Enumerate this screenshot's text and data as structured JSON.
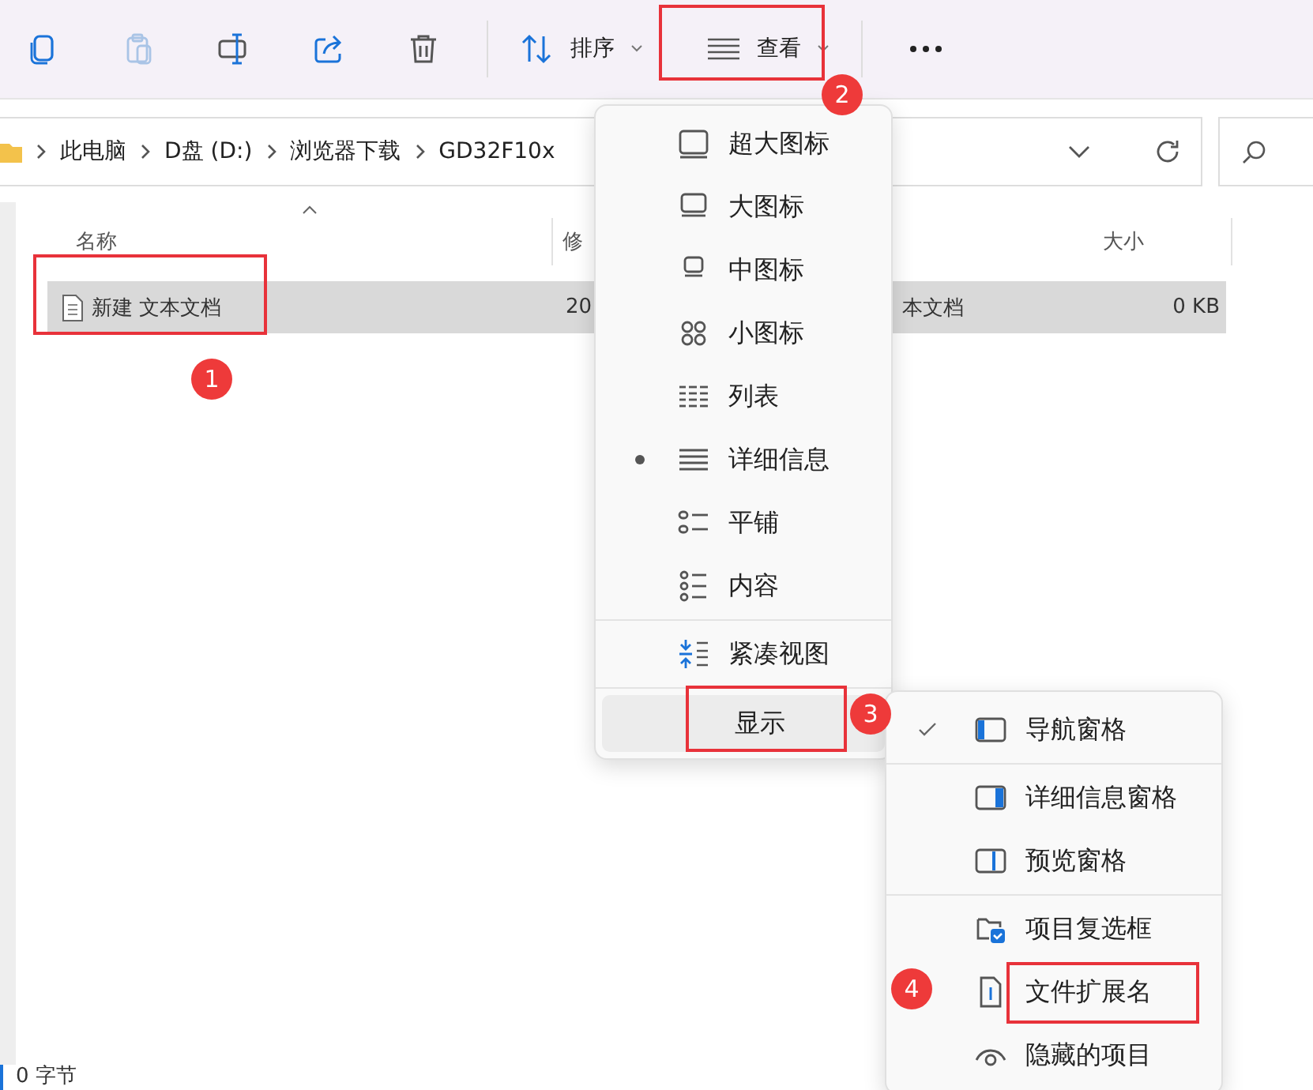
{
  "toolbar": {
    "sort_label": "排序",
    "view_label": "查看"
  },
  "address_bar": {
    "crumbs": [
      "此电脑",
      "D盘 (D:)",
      "浏览器下载",
      "GD32F10x"
    ]
  },
  "file_list": {
    "columns": [
      "名称",
      "修",
      "大小"
    ],
    "rows": [
      {
        "name": "新建 文本文档",
        "date": "20",
        "type": "本文档",
        "size": "0 KB",
        "selected": true
      }
    ]
  },
  "view_menu": {
    "items": [
      {
        "label": "超大图标",
        "selected": false
      },
      {
        "label": "大图标",
        "selected": false
      },
      {
        "label": "中图标",
        "selected": false
      },
      {
        "label": "小图标",
        "selected": false
      },
      {
        "label": "列表",
        "selected": false
      },
      {
        "label": "详细信息",
        "selected": true
      },
      {
        "label": "平铺",
        "selected": false
      },
      {
        "label": "内容",
        "selected": false
      }
    ],
    "compact_label": "紧凑视图",
    "show_label": "显示"
  },
  "show_menu": {
    "items": [
      {
        "label": "导航窗格",
        "checked": true
      },
      {
        "label": "详细信息窗格",
        "checked": false
      },
      {
        "label": "预览窗格",
        "checked": false
      },
      {
        "label": "项目复选框",
        "checked": false
      },
      {
        "label": "文件扩展名",
        "checked": false
      },
      {
        "label": "隐藏的项目",
        "checked": false
      }
    ]
  },
  "callouts": [
    "1",
    "2",
    "3",
    "4"
  ],
  "status_bar": {
    "size": "0 字节"
  }
}
